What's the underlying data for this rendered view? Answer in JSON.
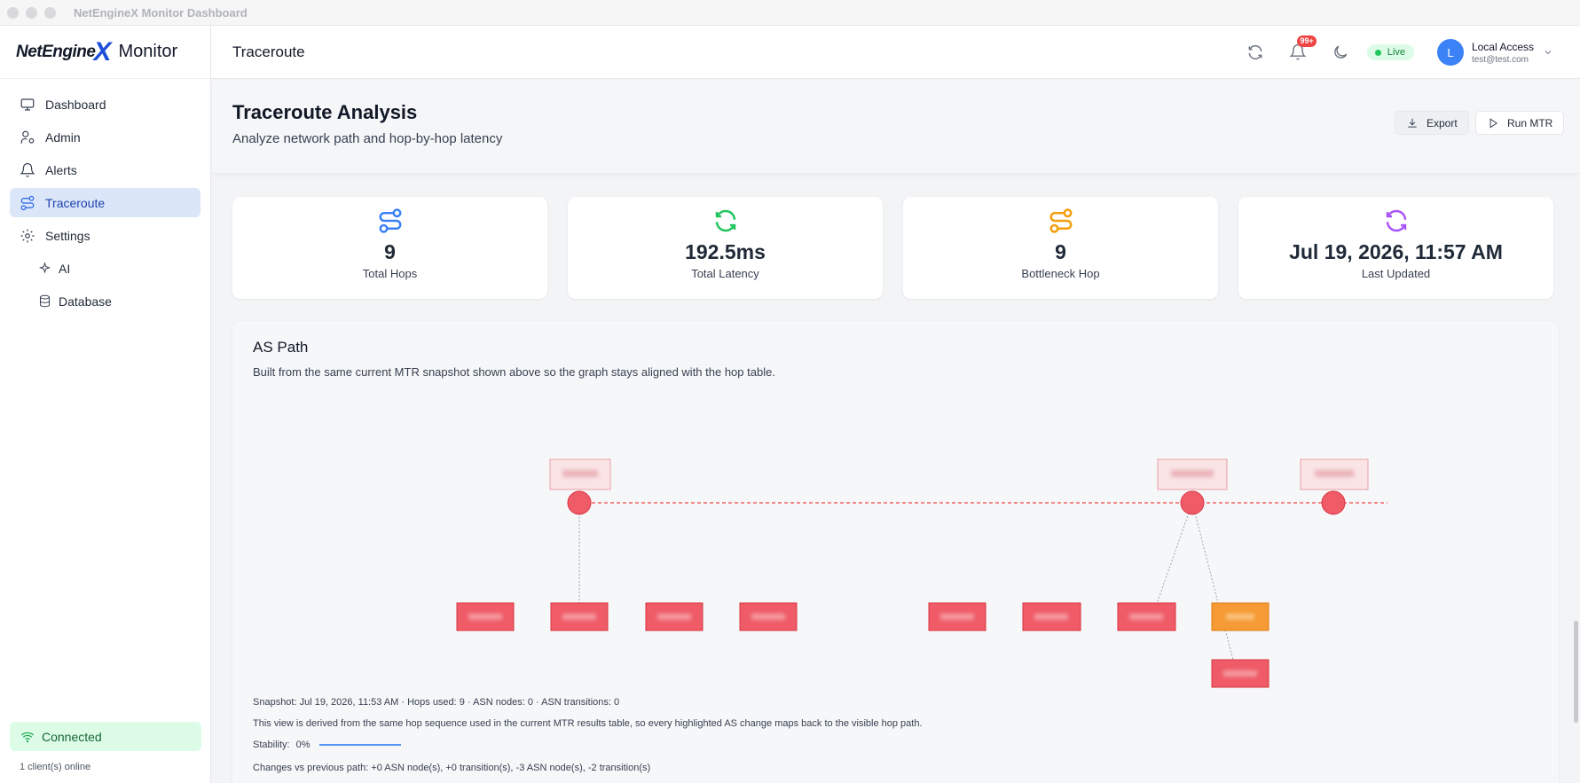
{
  "window": {
    "title": "NetEngineX Monitor Dashboard"
  },
  "brand": {
    "logo_word": "NetEngine",
    "logo_x": "X",
    "suffix": "Monitor"
  },
  "sidebar": {
    "items": [
      {
        "label": "Dashboard",
        "icon": "monitor-icon"
      },
      {
        "label": "Admin",
        "icon": "user-gear-icon"
      },
      {
        "label": "Alerts",
        "icon": "bell-icon"
      },
      {
        "label": "Traceroute",
        "icon": "route-icon",
        "active": true
      },
      {
        "label": "Settings",
        "icon": "gear-icon"
      },
      {
        "label": "AI",
        "icon": "sparkles-icon",
        "sub": true
      },
      {
        "label": "Database",
        "icon": "database-icon",
        "sub": true
      }
    ],
    "connection": {
      "label": "Connected",
      "clients": "1 client(s) online"
    }
  },
  "header": {
    "title": "Traceroute",
    "notifications_badge": "99+",
    "live_label": "Live",
    "user": {
      "initial": "L",
      "name": "Local Access",
      "email": "test@test.com"
    }
  },
  "page": {
    "title": "Traceroute Analysis",
    "subtitle": "Analyze network path and hop-by-hop latency",
    "export_label": "Export",
    "run_label": "Run MTR"
  },
  "stats": [
    {
      "value": "9",
      "label": "Total Hops",
      "color": "#3b82f6",
      "icon": "route-icon"
    },
    {
      "value": "192.5ms",
      "label": "Total Latency",
      "color": "#22c55e",
      "icon": "refresh-icon"
    },
    {
      "value": "9",
      "label": "Bottleneck Hop",
      "color": "#f59e0b",
      "icon": "route-icon"
    },
    {
      "value": "Jul 19, 2026, 11:57 AM",
      "label": "Last Updated",
      "color": "#a855f7",
      "icon": "refresh-icon"
    }
  ],
  "as_path": {
    "title": "AS Path",
    "description": "Built from the same current MTR snapshot shown above so the graph stays aligned with the hop table.",
    "snapshot": "Snapshot: Jul 19, 2026, 11:53 AM · Hops used: 9 · ASN nodes: 0 · ASN transitions: 0",
    "derived_note": "This view is derived from the same hop sequence used in the current MTR results table, so every highlighted AS change maps back to the visible hop path.",
    "stability_label": "Stability:",
    "stability_value": "0%",
    "changes": "Changes vs previous path: +0 ASN node(s), +0 transition(s), -3 ASN node(s), -2 transition(s)"
  },
  "colors": {
    "accent": "#2563eb",
    "node": "#ef5b67",
    "bottleneck": "#f59a34",
    "connected_bg": "#dcfce7"
  }
}
